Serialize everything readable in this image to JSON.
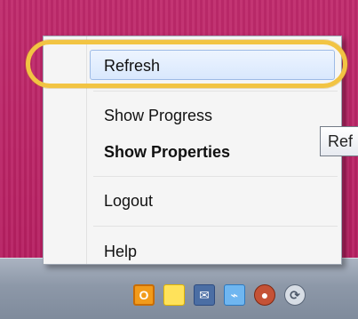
{
  "menu": {
    "items": [
      {
        "label": "Refresh"
      },
      {
        "label": "Show Progress"
      },
      {
        "label": "Show Properties"
      },
      {
        "label": "Logout"
      },
      {
        "label": "Help"
      }
    ]
  },
  "tooltip": {
    "text": "Ref"
  },
  "tray": {
    "icons": [
      {
        "name": "office-icon"
      },
      {
        "name": "sticky-note-icon"
      },
      {
        "name": "mail-icon"
      },
      {
        "name": "network-icon"
      },
      {
        "name": "user-status-icon"
      },
      {
        "name": "sync-icon"
      }
    ]
  },
  "colors": {
    "desktop": "#b51f5f",
    "menu_background": "#f5f5f5",
    "highlight_ring": "#f2c443",
    "selected_item": "#d9e8fd"
  }
}
